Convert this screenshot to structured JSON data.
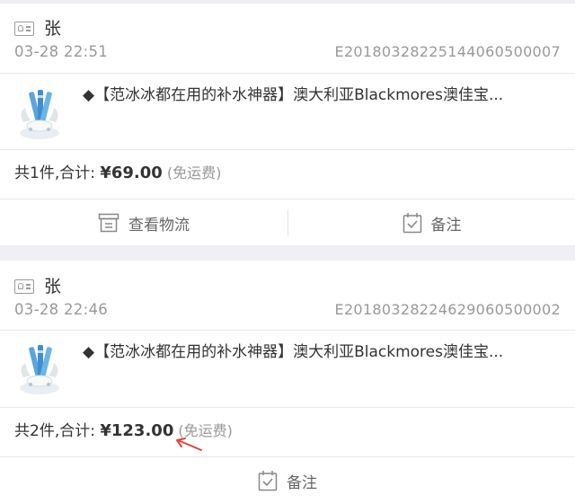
{
  "orders": [
    {
      "customer_name": "张",
      "datetime": "03-28 22:51",
      "order_no": "E20180328225144060500007",
      "product_title": "◆【范冰冰都在用的补水神器】澳大利亚Blackmores澳佳宝...",
      "summary_prefix": "共1件,合计: ",
      "price": "¥69.00",
      "shipping": " (免运费)",
      "actions": {
        "logistics_label": "查看物流",
        "remark_label": "备注"
      }
    },
    {
      "customer_name": "张",
      "datetime": "03-28 22:46",
      "order_no": "E20180328224629060500002",
      "product_title": "◆【范冰冰都在用的补水神器】澳大利亚Blackmores澳佳宝...",
      "summary_prefix": "共2件,合计: ",
      "price": "¥123.00",
      "shipping": " (免运费)",
      "actions": {
        "remark_label": "备注"
      }
    }
  ],
  "colors": {
    "background": "#efeff4",
    "card": "#ffffff",
    "muted_text": "#999999",
    "primary_text": "#333333",
    "annotation_arrow": "#e0443a"
  },
  "icons": {
    "customer": "id-card-icon",
    "logistics": "logistics-box-icon",
    "remark": "calendar-check-icon"
  }
}
